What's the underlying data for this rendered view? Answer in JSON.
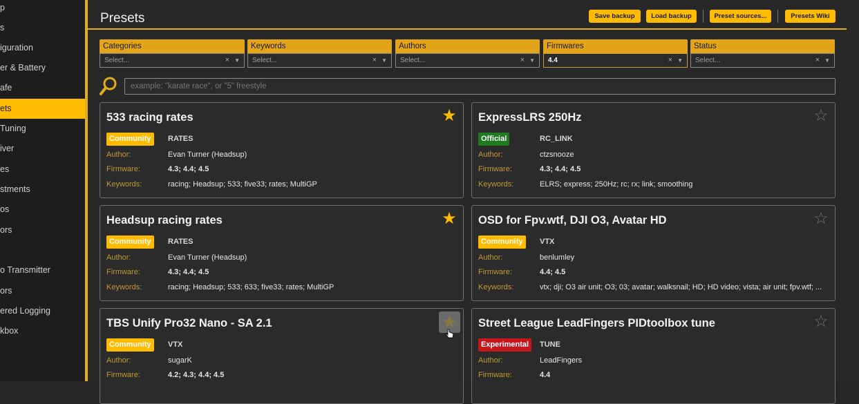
{
  "sidebar": {
    "items": [
      {
        "label": "p"
      },
      {
        "label": "s"
      },
      {
        "label": "iguration"
      },
      {
        "label": "er & Battery"
      },
      {
        "label": "afe"
      },
      {
        "label": "ets"
      },
      {
        "label": "Tuning"
      },
      {
        "label": "iver"
      },
      {
        "label": "es"
      },
      {
        "label": "stments"
      },
      {
        "label": "os"
      },
      {
        "label": "ors"
      },
      {
        "label": "o Transmitter"
      },
      {
        "label": "ors"
      },
      {
        "label": "ered Logging"
      },
      {
        "label": "kbox"
      }
    ]
  },
  "header": {
    "title": "Presets",
    "save_backup": "Save backup",
    "load_backup": "Load backup",
    "preset_sources": "Preset sources...",
    "presets_wiki": "Presets Wiki"
  },
  "filters": [
    {
      "label": "Categories",
      "value": "Select...",
      "filled": false
    },
    {
      "label": "Keywords",
      "value": "Select...",
      "filled": false
    },
    {
      "label": "Authors",
      "value": "Select...",
      "filled": false
    },
    {
      "label": "Firmwares",
      "value": "4.4",
      "filled": true
    },
    {
      "label": "Status",
      "value": "Select...",
      "filled": false
    }
  ],
  "filter_clear": "×",
  "filter_caret": "▼",
  "search": {
    "placeholder": "example: \"karate race\", or \"5\" freestyle"
  },
  "row_labels": {
    "author": "Author:",
    "firmware": "Firmware:",
    "keywords": "Keywords:"
  },
  "cards": [
    {
      "title": "533 racing rates",
      "badge": "Community",
      "category": "RATES",
      "author": "Evan Turner (Headsup)",
      "firmware": "4.3; 4.4; 4.5",
      "keywords": "racing; Headsup; 533; five33; rates; MultiGP",
      "favorite": true
    },
    {
      "title": "ExpressLRS 250Hz",
      "badge": "Official",
      "category": "RC_LINK",
      "author": "ctzsnooze",
      "firmware": "4.3; 4.4; 4.5",
      "keywords": "ELRS; express; 250Hz; rc; rx; link; smoothing",
      "favorite": false
    },
    {
      "title": "Headsup racing rates",
      "badge": "Community",
      "category": "RATES",
      "author": "Evan Turner (Headsup)",
      "firmware": "4.3; 4.4; 4.5",
      "keywords": "racing; Headsup; 533; 633; five33; rates; MultiGP",
      "favorite": true
    },
    {
      "title": "OSD for Fpv.wtf, DJI O3, Avatar HD",
      "badge": "Community",
      "category": "VTX",
      "author": "benlumley",
      "firmware": "4.4; 4.5",
      "keywords": "vtx; dji; O3 air unit; O3; 03; avatar; walksnail; HD; HD video; vista; air unit; fpv.wtf; ...",
      "favorite": false
    },
    {
      "title": "TBS Unify Pro32 Nano - SA 2.1",
      "badge": "Community",
      "category": "VTX",
      "author": "sugarK",
      "firmware": "4.2; 4.3; 4.4; 4.5",
      "keywords": "",
      "favorite": false
    },
    {
      "title": "Street League LeadFingers PIDtoolbox tune",
      "badge": "Experimental",
      "category": "TUNE",
      "author": "LeadFingers",
      "firmware": "4.4",
      "keywords": "",
      "favorite": false
    }
  ],
  "icons": {
    "star_filled": "★",
    "star_empty": "☆"
  },
  "colors": {
    "accent": "#ffbb00",
    "border_accent": "#e3ac19",
    "official": "#1e7a1e",
    "experimental": "#c4161c"
  }
}
